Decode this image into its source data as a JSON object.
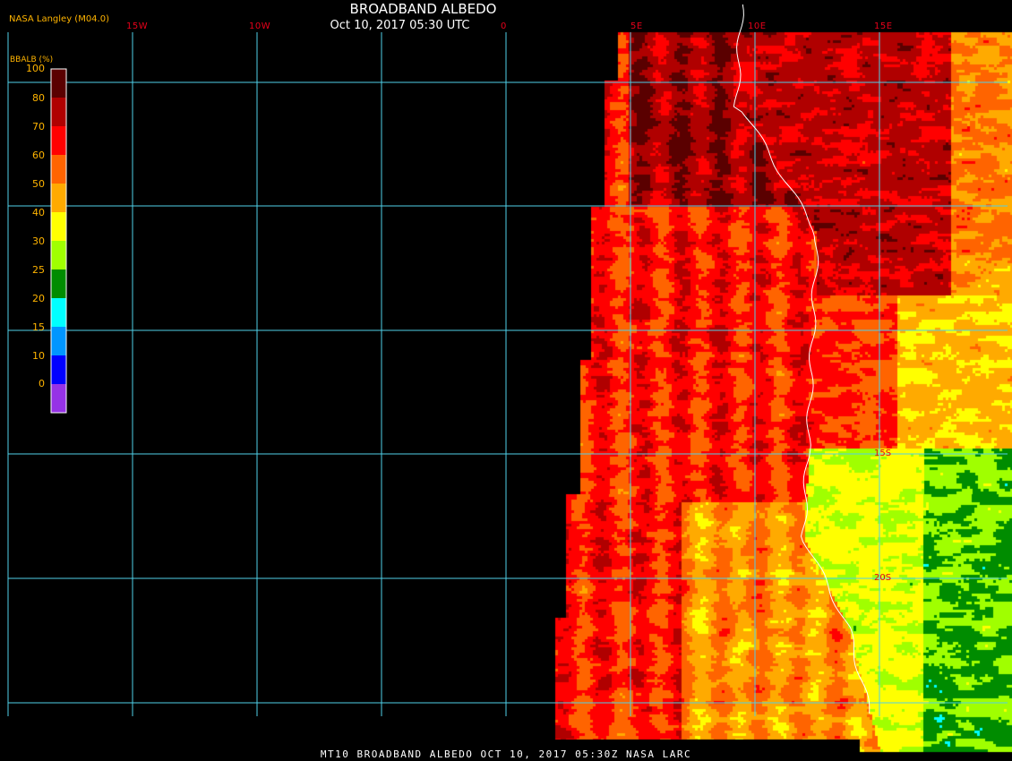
{
  "header": {
    "title": "BROADBAND ALBEDO",
    "subtitle": "Oct 10, 2017 05:30 UTC",
    "producer": "NASA Langley (M04.0)"
  },
  "legend": {
    "title": "BBALB (%)",
    "ticks": [
      "100",
      "80",
      "70",
      "60",
      "50",
      "40",
      "30",
      "25",
      "20",
      "15",
      "10",
      "0"
    ],
    "colors": [
      "#5a0000",
      "#b00000",
      "#ff0000",
      "#ff6400",
      "#ffaa00",
      "#ffff00",
      "#a0ff00",
      "#008c00",
      "#00ffff",
      "#0096ff",
      "#0000ff",
      "#9632e6"
    ]
  },
  "map": {
    "lon_labels": [
      "15W",
      "10W",
      "0",
      "5E",
      "10E",
      "15E"
    ],
    "lat_labels": [
      "15S",
      "20S"
    ],
    "grid_color": "#4fd0e8",
    "coast_color": "#ffffff",
    "label_color": "#e8001a"
  },
  "footer": {
    "text": "MT10  BROADBAND ALBEDO  OCT 10, 2017 05:30Z  NASA LARC"
  }
}
